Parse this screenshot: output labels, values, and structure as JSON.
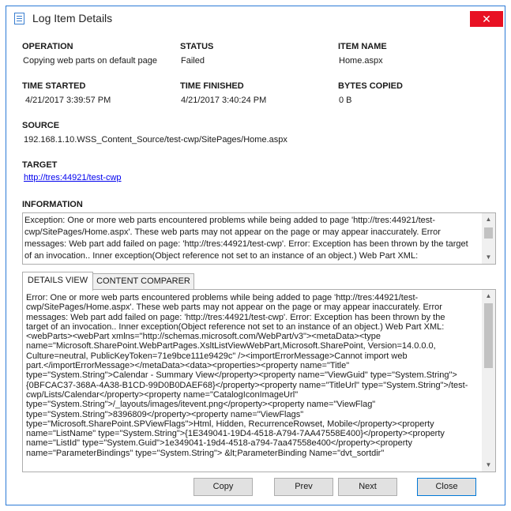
{
  "window": {
    "title": "Log Item Details",
    "close_glyph": "✕"
  },
  "fields": {
    "operation": {
      "label": "OPERATION",
      "value": "Copying web parts on default page"
    },
    "status": {
      "label": "STATUS",
      "value": "Failed"
    },
    "item_name": {
      "label": "ITEM NAME",
      "value": "Home.aspx"
    },
    "time_started": {
      "label": "TIME STARTED",
      "value": "4/21/2017 3:39:57 PM"
    },
    "time_finished": {
      "label": "TIME FINISHED",
      "value": "4/21/2017 3:40:24 PM"
    },
    "bytes_copied": {
      "label": "BYTES COPIED",
      "value": "0 B"
    },
    "source": {
      "label": "SOURCE",
      "value": "192.168.1.10.WSS_Content_Source/test-cwp/SitePages/Home.aspx"
    },
    "target": {
      "label": "TARGET",
      "value": "http://tres:44921/test-cwp"
    }
  },
  "information": {
    "label": "INFORMATION",
    "lines": [
      "Exception: One or more web parts encountered problems while being added to page 'http://tres:44921/test-",
      "cwp/SitePages/Home.aspx'. These web parts may not appear on the page or may appear inaccurately. Error",
      "messages: Web part add failed on page: 'http://tres:44921/test-cwp'. Error: Exception has been thrown by the target",
      "of an invocation.. Inner exception(Object reference not set to an instance of an object.) Web Part XML:"
    ]
  },
  "tabs": [
    {
      "label": "DETAILS VIEW",
      "active": true
    },
    {
      "label": "CONTENT COMPARER",
      "active": false
    }
  ],
  "details": {
    "lines": [
      "Error: One or more web parts encountered problems while being added to page 'http://tres:44921/test-",
      "cwp/SitePages/Home.aspx'. These web parts may not appear on the page or may appear inaccurately. Error",
      "messages: Web part add failed on page: 'http://tres:44921/test-cwp'. Error: Exception has been thrown by the",
      "target of an invocation.. Inner exception(Object reference not set to an instance of an object.) Web Part XML:",
      "<webParts><webPart xmlns=\"http://schemas.microsoft.com/WebPart/v3\"><metaData><type",
      "name=\"Microsoft.SharePoint.WebPartPages.XsltListViewWebPart,Microsoft.SharePoint, Version=14.0.0.0,",
      "Culture=neutral, PublicKeyToken=71e9bce111e9429c\" /><importErrorMessage>Cannot import web",
      "part.</importErrorMessage></metaData><data><properties><property name=\"Title\"",
      "type=\"System.String\">Calendar - Summary View</property><property name=\"ViewGuid\" type=\"System.String\">",
      "{0BFCAC37-368A-4A38-B1CD-99D0B0DAEF68}</property><property name=\"TitleUrl\" type=\"System.String\">/test-",
      "cwp/Lists/Calendar</property><property name=\"CatalogIconImageUrl\"",
      "type=\"System.String\">/_layouts/images/itevent.png</property><property name=\"ViewFlag\"",
      "type=\"System.String\">8396809</property><property name=\"ViewFlags\"",
      "type=\"Microsoft.SharePoint.SPViewFlags\">Html, Hidden, RecurrenceRowset, Mobile</property><property",
      "name=\"ListName\" type=\"System.String\">{1E349041-19D4-4518-A794-7AA47558E400}</property><property",
      "name=\"ListId\" type=\"System.Guid\">1e349041-19d4-4518-a794-7aa47558e400</property><property",
      "name=\"ParameterBindings\" type=\"System.String\">  &lt;ParameterBinding Name=\"dvt_sortdir\""
    ]
  },
  "scroll": {
    "up_glyph": "▲",
    "down_glyph": "▼"
  },
  "buttons": {
    "copy": "Copy",
    "prev": "Prev",
    "next": "Next",
    "close": "Close"
  },
  "colors": {
    "window_border": "#2b7bd6",
    "close_red": "#e81123",
    "link": "#0000ee"
  },
  "icons": {
    "title": "document-icon"
  }
}
